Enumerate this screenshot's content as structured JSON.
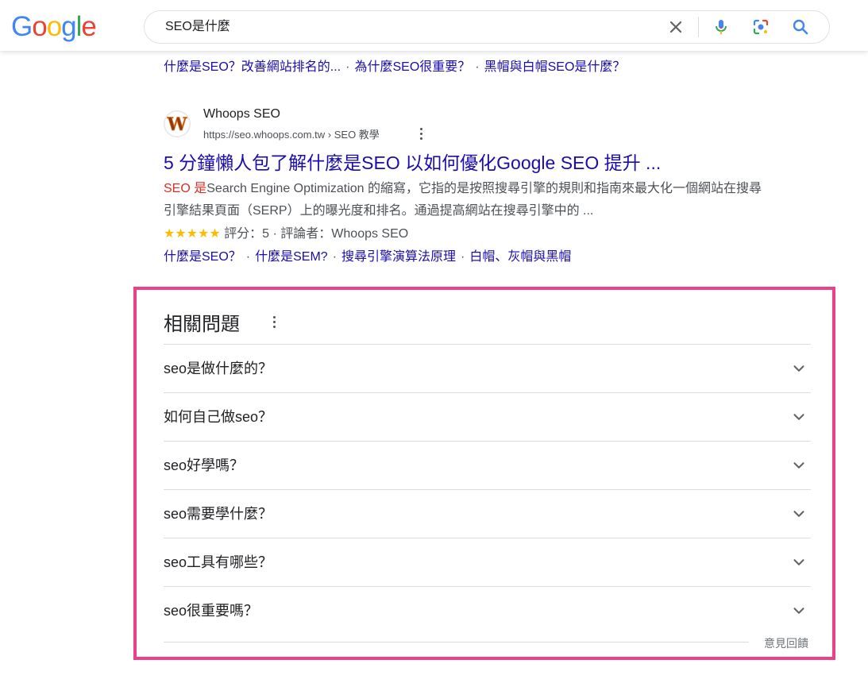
{
  "header": {
    "logo_letters": [
      "G",
      "o",
      "o",
      "g",
      "l",
      "e"
    ],
    "logo_colors": [
      "#4285F4",
      "#EA4335",
      "#FBBC05",
      "#4285F4",
      "#34A853",
      "#EA4335"
    ],
    "search": {
      "query": "SEO是什麼"
    },
    "icons": [
      "clear-icon",
      "microphone-icon",
      "lens-icon",
      "search-icon"
    ]
  },
  "top_sitelinks": {
    "links": [
      "什麼是SEO？改善網站排名的...",
      "為什麼SEO很重要？",
      "黑帽與白帽SEO是什麼？"
    ],
    "separator": "·"
  },
  "result": {
    "site_name": "Whoops SEO",
    "url": "https://seo.whoops.com.tw › SEO 教學",
    "favicon_letter": "W",
    "title": "5 分鐘懶人包了解什麼是SEO 以如何優化Google SEO 提升 ...",
    "snippet_highlight": "SEO 是",
    "snippet_rest": "Search Engine Optimization 的縮寫，它指的是按照搜尋引擎的規則和指南來最大化一個網站在搜尋引擎結果頁面（SERP）上的曝光度和排名。通過提高網站在搜尋引擎中的 ...",
    "stars": "★★★★★",
    "rating_text": "評分：5 · 評論者：Whoops SEO",
    "rating_value": 5,
    "sitelinks": [
      "什麼是SEO？",
      "什麼是SEM?",
      "搜尋引擎演算法原理",
      "白帽、灰帽與黑帽"
    ]
  },
  "people_also_ask": {
    "title": "相關問題",
    "questions": [
      "seo是做什麼的？",
      "如何自己做seo？",
      "seo好學嗎？",
      "seo需要學什麼？",
      "seo工具有哪些？",
      "seo很重要嗎？"
    ],
    "feedback": "意見回饋",
    "highlight_color": "#ec4188"
  }
}
